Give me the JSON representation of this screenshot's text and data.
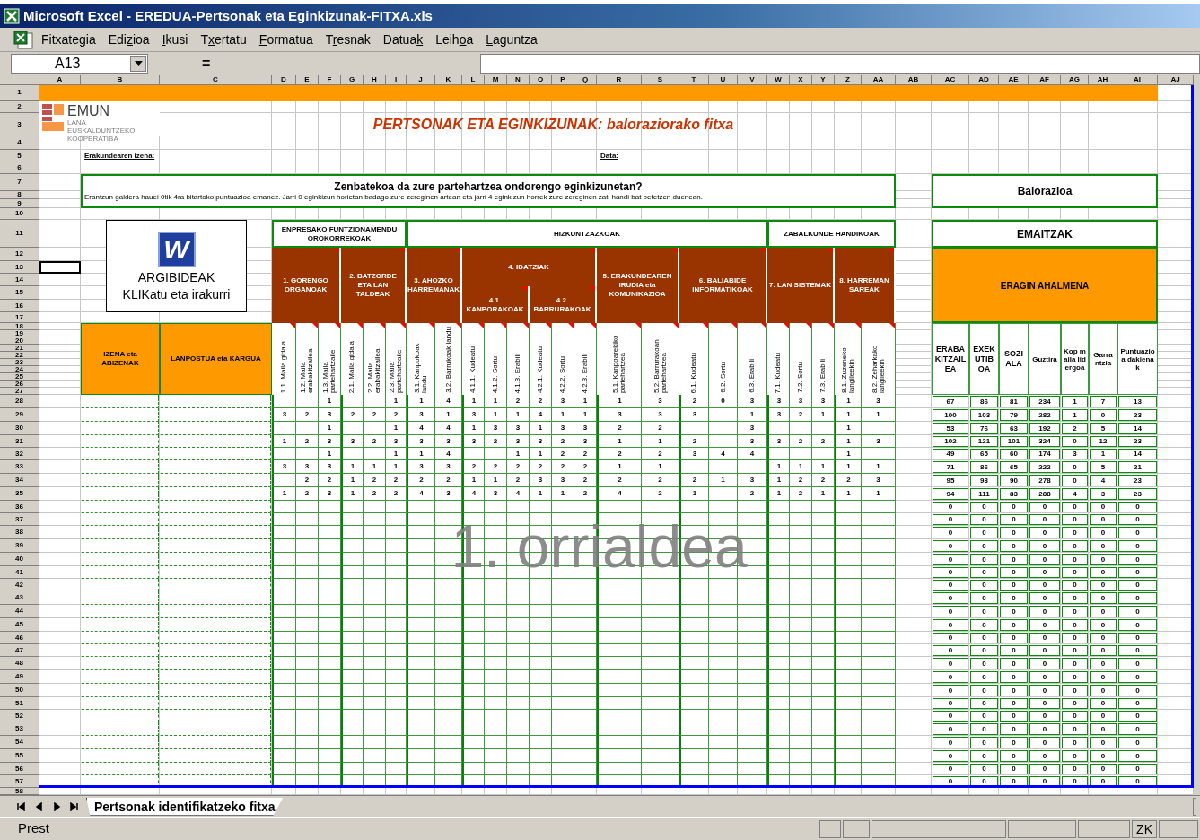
{
  "window": {
    "title": "Microsoft Excel - EREDUA-Pertsonak eta Eginkizunak-FITXA.xls"
  },
  "menu": [
    {
      "before": "Fitxate",
      "key": "g",
      "after": "ia"
    },
    {
      "before": "Edi",
      "key": "z",
      "after": "ioa"
    },
    {
      "key": "I",
      "after": "kusi"
    },
    {
      "before": "T",
      "key": "x",
      "after": "ertatu"
    },
    {
      "key": "F",
      "after": "ormatua"
    },
    {
      "before": "T",
      "key": "r",
      "after": "esnak"
    },
    {
      "before": "Datua",
      "key": "k"
    },
    {
      "before": "Leih",
      "key": "o",
      "after": "a"
    },
    {
      "key": "L",
      "after": "aguntza"
    }
  ],
  "formula_bar": {
    "name_box": "A13",
    "equals": "="
  },
  "column_headers": [
    "A",
    "B",
    "C",
    "D",
    "E",
    "F",
    "G",
    "H",
    "I",
    "J",
    "K",
    "L",
    "M",
    "N",
    "O",
    "P",
    "Q",
    "R",
    "S",
    "T",
    "U",
    "V",
    "W",
    "X",
    "Y",
    "Z",
    "AA",
    "AB",
    "AC",
    "AD",
    "AE",
    "AF",
    "AG",
    "AH",
    "AI",
    "AJ"
  ],
  "row_headers": [
    "1",
    "2",
    "3",
    "4",
    "5",
    "6",
    "7",
    "8",
    "9",
    "10",
    "11",
    "12",
    "13",
    "14",
    "15",
    "16",
    "17",
    "18",
    "19",
    "20",
    "21",
    "22",
    "23",
    "24",
    "25",
    "26",
    "27",
    "28",
    "29",
    "30",
    "31",
    "32",
    "33",
    "34",
    "35",
    "36",
    "37",
    "38",
    "39",
    "40",
    "41",
    "42",
    "43",
    "44",
    "45",
    "46",
    "47",
    "48",
    "49",
    "50",
    "51",
    "52",
    "53",
    "54",
    "55",
    "56",
    "57",
    "58"
  ],
  "sheet": {
    "logo": {
      "text": "EMUN",
      "subtitle": "LANA EUSKALDUNTZEKO KOOPERATIBA"
    },
    "title": "PERTSONAK ETA EGINKIZUNAK: baloraziorako fitxa",
    "org_label": "Erakundearen izena:",
    "date_label": "Data:",
    "question": {
      "title": "Zenbatekoa da zure partehartzea ondorengo eginkizunetan?",
      "text": "Erantzun galdera hauei 0tik 4ra bitartoko puntuazioa emanez. Jarri 0 eginkizun horietan badago zure zereginen artean eta jarri 4 eginkizun horrek zure zereginen zati handi bat betetzen duenean."
    },
    "valuation_label": "Balorazioa",
    "instructions": {
      "icon_letter": "W",
      "lines": [
        "ARGIBIDEAK",
        "KLIKatu eta irakurri"
      ]
    },
    "name_columns": [
      "IZENA eta ABIZENAK",
      "LANPOSTUA eta KARGUA"
    ],
    "areas": [
      {
        "label": "ENPRESAKO FUNTZIONAMENDU OROKORREKOAK",
        "groups": [
          {
            "label": "1. GORENGO ORGANOAK",
            "columns": [
              "1.1. Maila gidala",
              "1.2. Maila erabakitzailea",
              "1.3. Maila partehartzaile"
            ]
          },
          {
            "label": "2. BATZORDE ETA LAN TALDEAK",
            "columns": [
              "2.1. Maila gidala",
              "2.2. Maila erabakitzailea",
              "2.3. Maila partehartzaile"
            ]
          }
        ]
      },
      {
        "label": "HIZKUNTZAZKOAK",
        "groups": [
          {
            "label": "3. AHOZKO HARREMANAK",
            "columns": [
              "3.1. Kanpokoak landu",
              "3.2. Barrukoak landu"
            ]
          },
          {
            "label": "4. IDATZIAK",
            "subgroups": [
              {
                "label": "4.1. KANPORAKOAK",
                "columns": [
                  "4.1.1. Kudeatu",
                  "4.1.2. Sortu",
                  "4.1.3. Erabili"
                ]
              },
              {
                "label": "4.2. BARRURAKOAK",
                "columns": [
                  "4.2.1. Kudeatu",
                  "4.2.2. Sortu",
                  "4.2.3. Erabili"
                ]
              }
            ]
          },
          {
            "label": "5. ERAKUNDEAREN IRUDIA eta KOMUNIKAZIOA",
            "columns": [
              "5.1. Kanpoarekiko partehartzea",
              "5.2. Barrurakoan partehartzea"
            ]
          },
          {
            "label": "6. BALIABIDE INFORMATIKOAK",
            "columns": [
              "6.1. Kudeatu",
              "6.2. Sortu",
              "6.3. Erabili"
            ]
          }
        ]
      },
      {
        "label": "ZABALKUNDE HANDIKOAK",
        "groups": [
          {
            "label": "7. LAN SISTEMAK",
            "columns": [
              "7.1. Kudeatu",
              "7.2. Sortu",
              "7.3. Erabili"
            ]
          },
          {
            "label": "8. HARREMAN SAREAK",
            "columns": [
              "8.1. Zuzeneko langileekin",
              "8.2. Zeharkako langileekin"
            ]
          }
        ]
      }
    ],
    "score_rows": [
      [
        null,
        null,
        "1",
        null,
        null,
        "1",
        "1",
        "4",
        "1",
        "1",
        "2",
        "2",
        "3",
        "1",
        "1",
        "3",
        "2",
        "0",
        "3",
        "3",
        "3",
        "3",
        "1",
        "3"
      ],
      [
        "3",
        "2",
        "3",
        "2",
        "2",
        "2",
        "3",
        "1",
        "3",
        "1",
        "1",
        "4",
        "1",
        "1",
        "3",
        "3",
        "3",
        null,
        "1",
        "3",
        "2",
        "1",
        "1",
        "1"
      ],
      [
        null,
        null,
        "1",
        null,
        null,
        "1",
        "4",
        "4",
        "1",
        "3",
        "3",
        "1",
        "3",
        "3",
        "2",
        "2",
        null,
        null,
        "3",
        null,
        null,
        null,
        "1",
        null
      ],
      [
        "1",
        "2",
        "3",
        "3",
        "2",
        "3",
        "3",
        "3",
        "3",
        "2",
        "3",
        "3",
        "2",
        "3",
        "1",
        "1",
        "2",
        null,
        "3",
        "3",
        "2",
        "2",
        "1",
        "3"
      ],
      [
        null,
        null,
        "1",
        null,
        null,
        "1",
        "1",
        "4",
        null,
        null,
        "1",
        "1",
        "2",
        "2",
        "2",
        "2",
        "3",
        "4",
        "4",
        null,
        null,
        null,
        "1",
        null
      ],
      [
        "3",
        "3",
        "3",
        "1",
        "1",
        "1",
        "3",
        "3",
        "2",
        "2",
        "2",
        "2",
        "2",
        "2",
        "1",
        "1",
        null,
        null,
        null,
        "1",
        "1",
        "1",
        "1",
        "1"
      ],
      [
        null,
        "2",
        "2",
        "1",
        "2",
        "2",
        "2",
        "2",
        "1",
        "1",
        "2",
        "3",
        "3",
        "2",
        "2",
        "2",
        "2",
        "1",
        "3",
        "1",
        "2",
        "2",
        "2",
        "3"
      ],
      [
        "1",
        "2",
        "3",
        "1",
        "2",
        "2",
        "4",
        "3",
        "4",
        "3",
        "4",
        "1",
        "1",
        "2",
        "4",
        "2",
        "1",
        null,
        "2",
        "1",
        "2",
        "1",
        "1",
        "1"
      ]
    ],
    "results": {
      "title": "EMAITZAK",
      "subtitle": "ERAGIN AHALMENA",
      "columns": [
        "ERABAKITZAILEA",
        "EXEKUTIBOA",
        "SOZIALA",
        "Guztira",
        "Kop maila lidergoa",
        "Garrantzia",
        "Puntuazioa dakienak"
      ],
      "rows": [
        [
          "67",
          "86",
          "81",
          "234",
          "1",
          "7",
          "13"
        ],
        [
          "100",
          "103",
          "79",
          "282",
          "1",
          "0",
          "23"
        ],
        [
          "53",
          "76",
          "63",
          "192",
          "2",
          "5",
          "14"
        ],
        [
          "102",
          "121",
          "101",
          "324",
          "0",
          "12",
          "23"
        ],
        [
          "49",
          "65",
          "60",
          "174",
          "3",
          "1",
          "14"
        ],
        [
          "71",
          "86",
          "65",
          "222",
          "0",
          "5",
          "21"
        ],
        [
          "95",
          "93",
          "90",
          "278",
          "0",
          "4",
          "23"
        ],
        [
          "94",
          "111",
          "83",
          "288",
          "4",
          "3",
          "23"
        ],
        [
          "0",
          "0",
          "0",
          "0",
          "0",
          "0",
          "0"
        ],
        [
          "0",
          "0",
          "0",
          "0",
          "0",
          "0",
          "0"
        ],
        [
          "0",
          "0",
          "0",
          "0",
          "0",
          "0",
          "0"
        ],
        [
          "0",
          "0",
          "0",
          "0",
          "0",
          "0",
          "0"
        ],
        [
          "0",
          "0",
          "0",
          "0",
          "0",
          "0",
          "0"
        ],
        [
          "0",
          "0",
          "0",
          "0",
          "0",
          "0",
          "0"
        ],
        [
          "0",
          "0",
          "0",
          "0",
          "0",
          "0",
          "0"
        ],
        [
          "0",
          "0",
          "0",
          "0",
          "0",
          "0",
          "0"
        ],
        [
          "0",
          "0",
          "0",
          "0",
          "0",
          "0",
          "0"
        ],
        [
          "0",
          "0",
          "0",
          "0",
          "0",
          "0",
          "0"
        ],
        [
          "0",
          "0",
          "0",
          "0",
          "0",
          "0",
          "0"
        ],
        [
          "0",
          "0",
          "0",
          "0",
          "0",
          "0",
          "0"
        ],
        [
          "0",
          "0",
          "0",
          "0",
          "0",
          "0",
          "0"
        ],
        [
          "0",
          "0",
          "0",
          "0",
          "0",
          "0",
          "0"
        ],
        [
          "0",
          "0",
          "0",
          "0",
          "0",
          "0",
          "0"
        ],
        [
          "0",
          "0",
          "0",
          "0",
          "0",
          "0",
          "0"
        ],
        [
          "0",
          "0",
          "0",
          "0",
          "0",
          "0",
          "0"
        ],
        [
          "0",
          "0",
          "0",
          "0",
          "0",
          "0",
          "0"
        ],
        [
          "0",
          "0",
          "0",
          "0",
          "0",
          "0",
          "0"
        ],
        [
          "0",
          "0",
          "0",
          "0",
          "0",
          "0",
          "0"
        ],
        [
          "0",
          "0",
          "0",
          "0",
          "0",
          "0",
          "0"
        ],
        [
          "0",
          "0",
          "0",
          "0",
          "0",
          "0",
          "0"
        ]
      ]
    },
    "page_label": "1. orrialdea"
  },
  "sheet_tabs": [
    {
      "label": "Pertsonak identifikatzeko fitxa",
      "selected": true
    }
  ],
  "status_bar": {
    "text": "Prest",
    "indicators": [
      "ZK"
    ]
  }
}
